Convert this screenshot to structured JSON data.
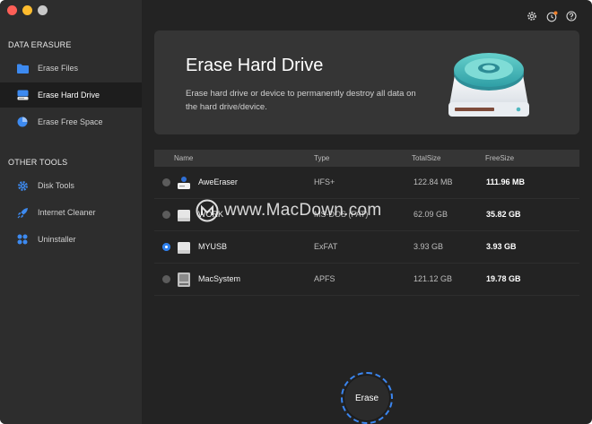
{
  "sidebar": {
    "sections": [
      {
        "title": "DATA ERASURE",
        "items": [
          {
            "label": "Erase Files",
            "icon": "folder-icon",
            "active": false
          },
          {
            "label": "Erase Hard Drive",
            "icon": "hard-drive-icon",
            "active": true
          },
          {
            "label": "Erase Free Space",
            "icon": "pie-chart-icon",
            "active": false
          }
        ]
      },
      {
        "title": "OTHER TOOLS",
        "items": [
          {
            "label": "Disk Tools",
            "icon": "gear-icon",
            "active": false
          },
          {
            "label": "Internet Cleaner",
            "icon": "rocket-icon",
            "active": false
          },
          {
            "label": "Uninstaller",
            "icon": "apps-grid-icon",
            "active": false
          }
        ]
      }
    ]
  },
  "topbar": {
    "icons": [
      "settings-icon",
      "history-icon",
      "help-icon"
    ]
  },
  "hero": {
    "title": "Erase Hard Drive",
    "description": "Erase hard drive or device to permanently destroy all data on the hard drive/device."
  },
  "table": {
    "headers": {
      "name": "Name",
      "type": "Type",
      "total": "TotalSize",
      "free": "FreeSize"
    },
    "rows": [
      {
        "name": "AweEraser",
        "type": "HFS+",
        "total": "122.84 MB",
        "free": "111.96 MB",
        "selected": false,
        "icon": "app-icon"
      },
      {
        "name": "WORK",
        "type": "MS-DOS (FAT)",
        "total": "62.09 GB",
        "free": "35.82 GB",
        "selected": false,
        "icon": "drive-icon"
      },
      {
        "name": "MYUSB",
        "type": "ExFAT",
        "total": "3.93 GB",
        "free": "3.93 GB",
        "selected": true,
        "icon": "drive-icon"
      },
      {
        "name": "MacSystem",
        "type": "APFS",
        "total": "121.12 GB",
        "free": "19.78 GB",
        "selected": false,
        "icon": "system-drive-icon"
      }
    ]
  },
  "actions": {
    "erase_label": "Erase"
  },
  "watermark": {
    "text": "www.MacDown.com"
  },
  "colors": {
    "accent": "#2f80ed",
    "background": "#232323",
    "sidebar": "#2d2d2d"
  }
}
